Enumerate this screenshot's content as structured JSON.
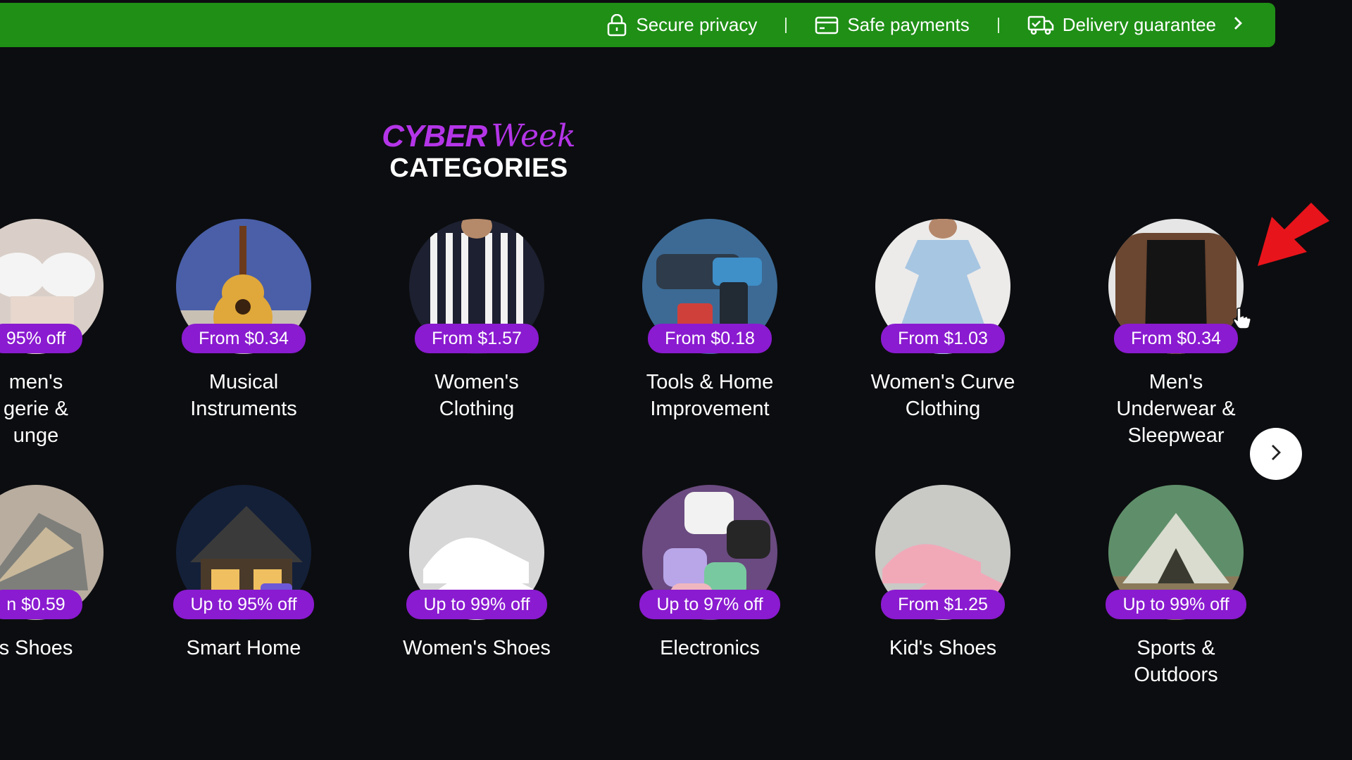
{
  "trust_bar": {
    "items": [
      {
        "label": "Secure privacy",
        "icon": "lock-icon"
      },
      {
        "label": "Safe payments",
        "icon": "card-icon"
      },
      {
        "label": "Delivery guarantee",
        "icon": "truck-check-icon"
      }
    ],
    "colors": {
      "bar": "#1f8f16"
    }
  },
  "heading": {
    "line1_a": "CYBER",
    "line1_b": "Week",
    "line2": "CATEGORIES"
  },
  "categories": {
    "row1": [
      {
        "badge": "95% off",
        "name": "men's\ngerie &\nunge",
        "img": "lingerie"
      },
      {
        "badge": "From $0.34",
        "name": "Musical Instruments",
        "img": "guitar"
      },
      {
        "badge": "From $1.57",
        "name": "Women's Clothing",
        "img": "stripes"
      },
      {
        "badge": "From $0.18",
        "name": "Tools & Home Improvement",
        "img": "drill"
      },
      {
        "badge": "From $1.03",
        "name": "Women's Curve Clothing",
        "img": "dress"
      },
      {
        "badge": "From $0.34",
        "name": "Men's Underwear & Sleepwear",
        "img": "tank"
      }
    ],
    "row2": [
      {
        "badge": "n $0.59",
        "name": "s Shoes",
        "img": "sneaker-gray"
      },
      {
        "badge": "Up to 95% off",
        "name": "Smart Home",
        "img": "house"
      },
      {
        "badge": "Up to 99% off",
        "name": "Women's Shoes",
        "img": "sneaker-white"
      },
      {
        "badge": "Up to 97% off",
        "name": "Electronics",
        "img": "earbuds"
      },
      {
        "badge": "From $1.25",
        "name": "Kid's Shoes",
        "img": "sneaker-pink"
      },
      {
        "badge": "Up to 99% off",
        "name": "Sports & Outdoors",
        "img": "tent"
      }
    ]
  },
  "colors": {
    "background": "#0c0d10",
    "badge": "#8a1bd0",
    "accent": "#b435e8",
    "annotation": "#e8141b"
  },
  "icons": {
    "next": "chevron-right-icon",
    "annotation": "red-arrow-icon",
    "cursor": "hand-cursor-icon"
  }
}
